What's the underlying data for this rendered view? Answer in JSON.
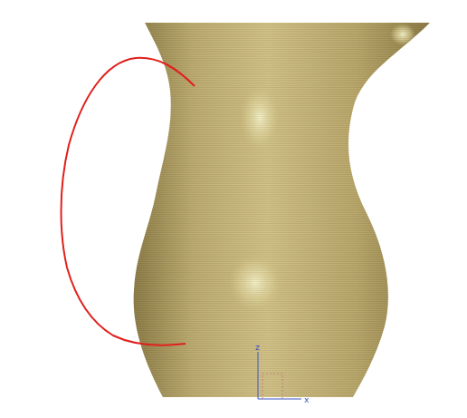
{
  "viewport": {
    "model": "pitcher-body",
    "sketch": "handle-curve"
  },
  "axes": [
    {
      "label": "z"
    },
    {
      "label": "x"
    }
  ]
}
